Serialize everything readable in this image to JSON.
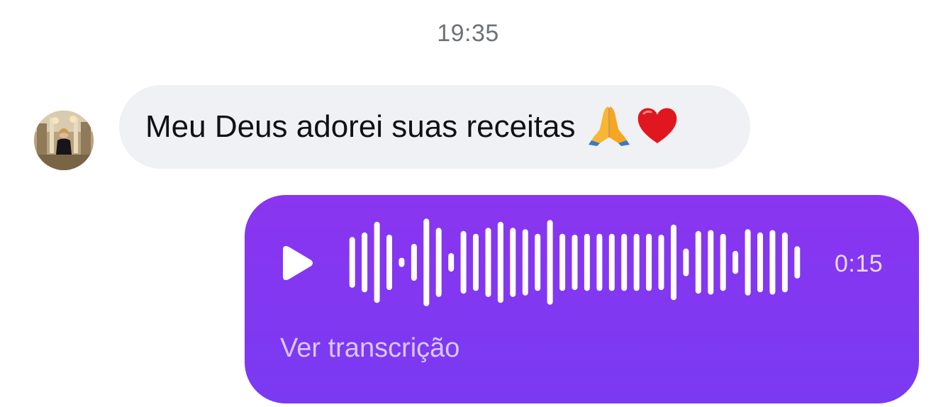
{
  "timestamp": "19:35",
  "incoming_message": {
    "avatar_icon": "profile-photo-avatar",
    "text": "Meu Deus adorei suas receitas",
    "emojis": [
      "folded-hands-emoji",
      "red-heart-emoji"
    ]
  },
  "voice_message": {
    "bubble_color": "#8339F0",
    "play_icon": "play-icon",
    "duration": "0:15",
    "transcript_link": "Ver transcrição",
    "waveform_levels": [
      0.55,
      0.65,
      0.88,
      0.6,
      0.1,
      0.4,
      0.95,
      0.75,
      0.2,
      0.68,
      0.62,
      0.75,
      0.88,
      0.75,
      0.72,
      0.62,
      0.92,
      0.62,
      0.6,
      0.62,
      0.62,
      0.62,
      0.62,
      0.62,
      0.62,
      0.6,
      0.82,
      0.3,
      0.68,
      0.7,
      0.62,
      0.25,
      0.72,
      0.65,
      0.7,
      0.65,
      0.35
    ]
  }
}
